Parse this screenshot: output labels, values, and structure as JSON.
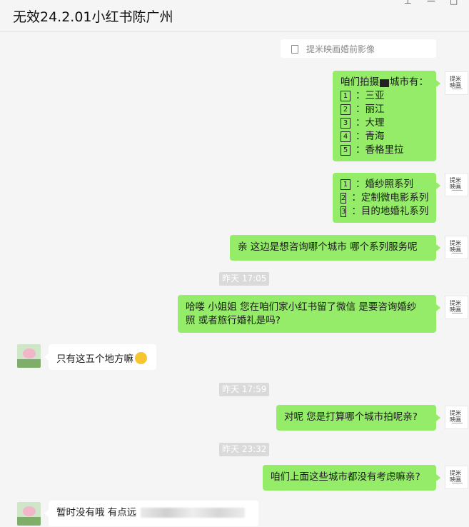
{
  "window": {
    "title": "无效24.2.01小红书陈广州",
    "pin_icon": "pin-icon",
    "minimize_icon": "minimize-icon",
    "maximize_icon": "maximize-icon"
  },
  "chat": {
    "link_card": {
      "text": "提米映画婚前影像",
      "icon": "document-icon"
    },
    "self_logo": "提米\n映画",
    "messages": [
      {
        "id": "cities_header",
        "from": "me",
        "lines": [
          "咱们拍摄",
          "城市有："
        ]
      },
      {
        "id": "cities",
        "from": "me",
        "items": [
          {
            "num": "1",
            "text": "三亚"
          },
          {
            "num": "2",
            "text": "丽江"
          },
          {
            "num": "3",
            "text": "大理"
          },
          {
            "num": "4",
            "text": "青海"
          },
          {
            "num": "5",
            "text": "香格里拉"
          }
        ]
      },
      {
        "id": "series",
        "from": "me",
        "items": [
          {
            "num": "1",
            "text": "婚纱照系列"
          },
          {
            "num": "2",
            "text": "定制微电影系列"
          },
          {
            "num": "3",
            "text": "目的地婚礼系列"
          }
        ]
      },
      {
        "id": "ask_city",
        "from": "me",
        "text": "亲  这边是想咨询哪个城市  哪个系列服务呢"
      },
      {
        "id": "time1",
        "type": "time",
        "text": "昨天 17:05"
      },
      {
        "id": "greeting",
        "from": "me",
        "lines": [
          "哈喽 小姐姐  您在咱们家小红书留了微信  是要咨询婚纱",
          "照 或者旅行婚礼是吗?"
        ]
      },
      {
        "id": "reply1",
        "from": "other",
        "text": "只有这五个地方嘛",
        "emoji": "laughing-emoji-icon"
      },
      {
        "id": "time2",
        "type": "time",
        "text": "昨天 17:59"
      },
      {
        "id": "ask_plan",
        "from": "me",
        "text": "对呢  您是打算哪个城市拍呢亲?"
      },
      {
        "id": "time3",
        "type": "time",
        "text": "昨天 23:32"
      },
      {
        "id": "ask_none",
        "from": "me",
        "text": "咱们上面这些城市都没有考虑嘛亲?"
      },
      {
        "id": "reply2",
        "from": "other",
        "text": "暂时没有哦 有点远"
      }
    ]
  },
  "colors": {
    "self_bubble": "#95ec69",
    "other_bubble": "#ffffff",
    "background": "#f5f5f5",
    "time_badge": "#dadada"
  }
}
